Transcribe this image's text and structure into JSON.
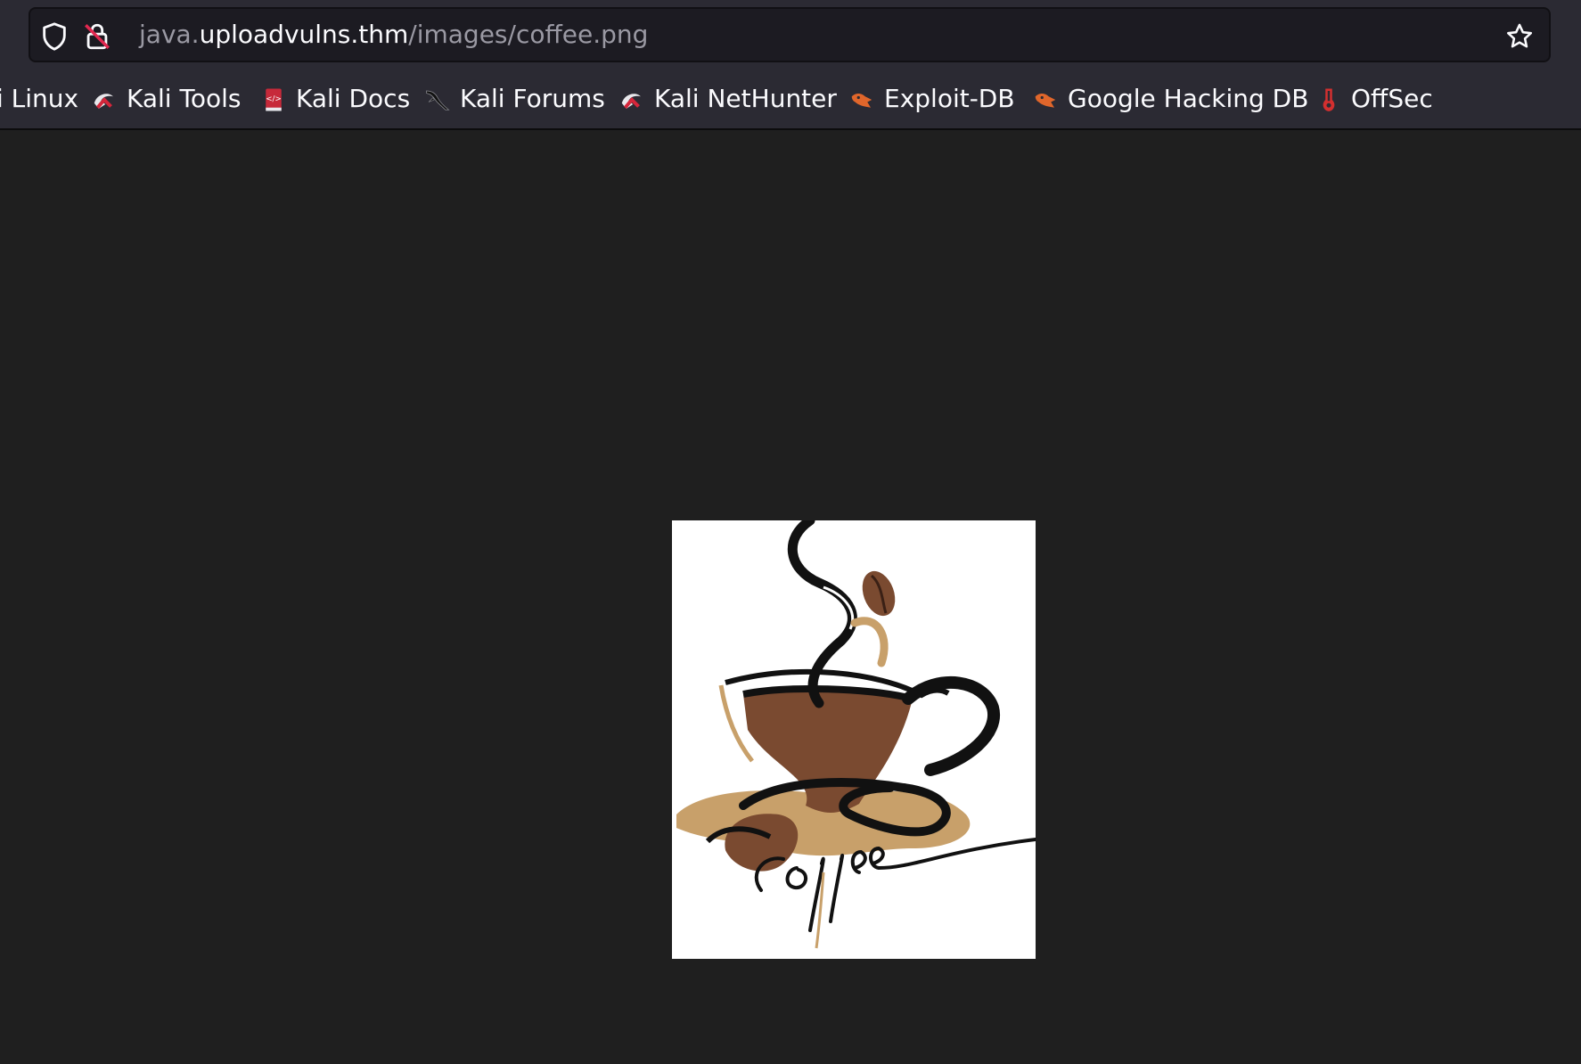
{
  "urlbar": {
    "url_prefix": "java.",
    "url_domain": "uploadvulns.thm",
    "url_path": "/images/coffee.png",
    "icons": [
      "shield-icon",
      "insecure-lock-icon",
      "star-icon"
    ]
  },
  "bookmarks": [
    {
      "label": "i Linux",
      "icon": "none"
    },
    {
      "label": "Kali Tools",
      "icon": "kali-icon"
    },
    {
      "label": "Kali Docs",
      "icon": "kali-docs-icon"
    },
    {
      "label": "Kali Forums",
      "icon": "kali-dragon-icon"
    },
    {
      "label": "Kali NetHunter",
      "icon": "kali-icon"
    },
    {
      "label": "Exploit-DB",
      "icon": "exploit-db-icon"
    },
    {
      "label": "Google Hacking DB",
      "icon": "exploit-db-icon"
    },
    {
      "label": "OffSec",
      "icon": "offsec-icon"
    }
  ],
  "page": {
    "image_name": "coffee.png",
    "image_caption": "Coffee"
  },
  "colors": {
    "chrome": "#2b2a33",
    "urlbar": "#1c1b22",
    "viewport": "#1f1f1f",
    "coffee_brown": "#7a4a30",
    "coffee_tan": "#c8a06a"
  }
}
